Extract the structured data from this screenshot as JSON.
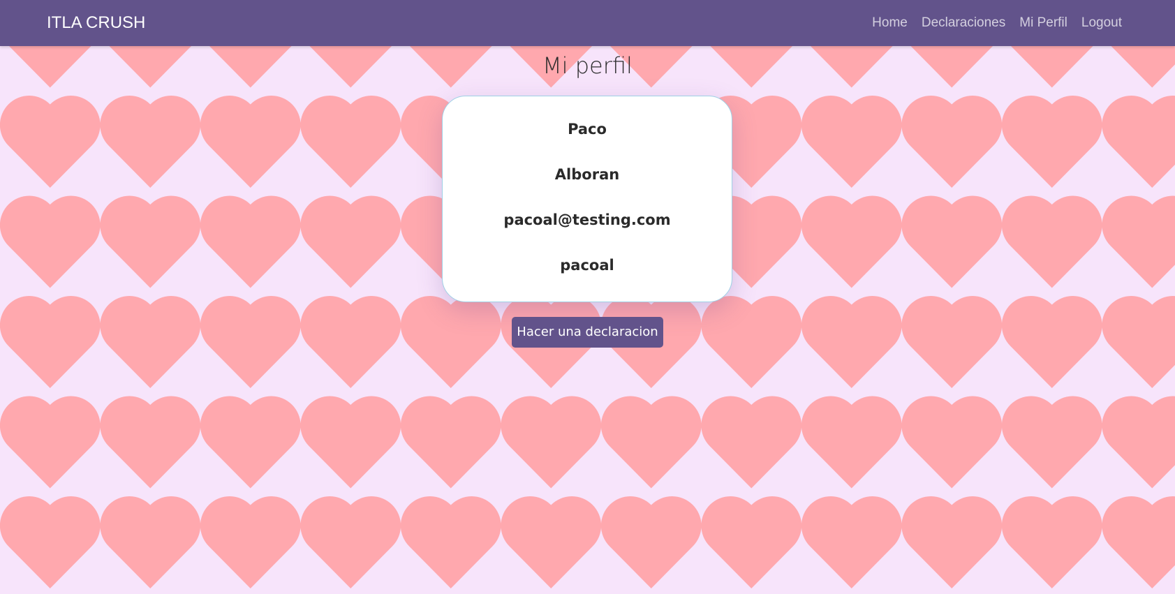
{
  "navbar": {
    "brand": "ITLA CRUSH",
    "links": [
      "Home",
      "Declaraciones",
      "Mi Perfil",
      "Logout"
    ]
  },
  "main": {
    "title": "Mi perfil",
    "profile": {
      "first_name": "Paco",
      "last_name": "Alboran",
      "email": "pacoal@testing.com",
      "username": "pacoal"
    },
    "action_label": "Hacer una declaracion"
  },
  "colors": {
    "navbar": "#62538b",
    "background": "#f7e4fb",
    "heart": "#ffa8ae",
    "card_border": "#9fd0e6"
  },
  "background_pattern_icon": "heart-icon"
}
